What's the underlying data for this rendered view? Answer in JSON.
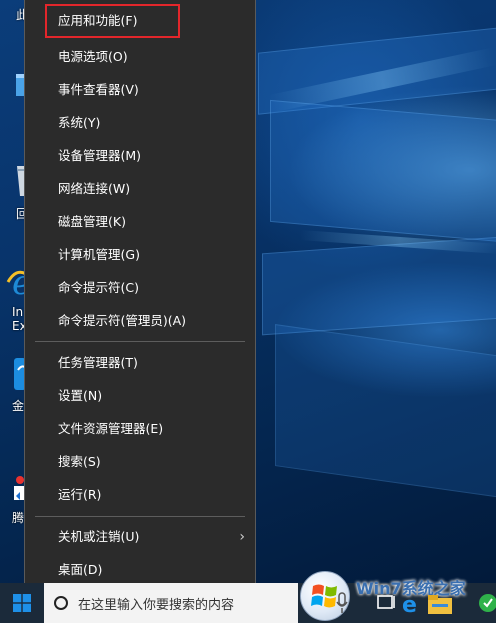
{
  "context_menu": {
    "items": [
      {
        "label": "应用和功能(F)"
      },
      {
        "label": "电源选项(O)"
      },
      {
        "label": "事件查看器(V)"
      },
      {
        "label": "系统(Y)"
      },
      {
        "label": "设备管理器(M)"
      },
      {
        "label": "网络连接(W)"
      },
      {
        "label": "磁盘管理(K)"
      },
      {
        "label": "计算机管理(G)"
      },
      {
        "label": "命令提示符(C)"
      },
      {
        "label": "命令提示符(管理员)(A)"
      },
      {
        "label": "任务管理器(T)"
      },
      {
        "label": "设置(N)"
      },
      {
        "label": "文件资源管理器(E)"
      },
      {
        "label": "搜索(S)"
      },
      {
        "label": "运行(R)"
      },
      {
        "label": "关机或注销(U)"
      },
      {
        "label": "桌面(D)"
      }
    ],
    "highlight_color": "#e3262b"
  },
  "desktop": {
    "icons": [
      {
        "label": "此",
        "icon": "this-pc-icon"
      },
      {
        "label": "回",
        "icon": "recycle-bin-icon"
      },
      {
        "label": "In",
        "icon": "internet-explorer-icon"
      },
      {
        "label": "Ex",
        "icon": "internet-explorer-icon"
      },
      {
        "label": "金",
        "icon": "app-shortcut-icon"
      },
      {
        "label": "腾",
        "icon": "tencent-shortcut-icon"
      }
    ]
  },
  "taskbar": {
    "search_placeholder": "在这里输入你要搜索的内容",
    "watermark_text": "Win7系统之家"
  },
  "colors": {
    "menu_bg": "#2b2b2b",
    "taskbar_bg": "#1b2a3a",
    "search_bg": "#f3f3f3",
    "accent_blue": "#0078d7"
  }
}
